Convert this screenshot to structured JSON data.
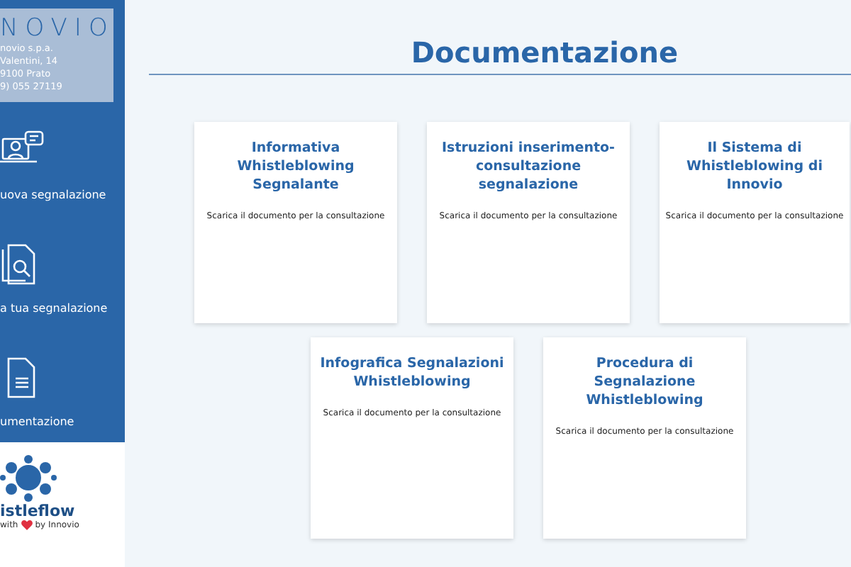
{
  "sidebar": {
    "logo": "NOVIO",
    "address": [
      "novio s.p.a.",
      "Valentini, 14",
      "9100 Prato",
      "9) 055 27119"
    ],
    "items": [
      {
        "kind": "new-report",
        "label": "uova segnalazione"
      },
      {
        "kind": "search-report",
        "label": "a tua segnalazione"
      },
      {
        "kind": "documents",
        "label": "umentazione"
      }
    ],
    "brand": {
      "name": "istleflow",
      "made_with": "with",
      "by": "by Innovio"
    }
  },
  "title": "Documentazione",
  "card_rows": [
    [
      {
        "title": "Informativa Whistleblowing Segnalante",
        "link": "Scarica il documento per la consultazione"
      },
      {
        "title": "Istruzioni inserimento-consultazione segnalazione",
        "link": "Scarica il documento per la consultazione"
      },
      {
        "title": "Il Sistema di Whistleblowing di Innovio",
        "link": "Scarica il documento per la consultazione"
      }
    ],
    [
      {
        "title": "Infografica Segnalazioni Whistleblowing",
        "link": "Scarica il documento per la consultazione"
      },
      {
        "title": "Procedura di Segnalazione Whistleblowing",
        "link": "Scarica il documento per la consultazione"
      }
    ]
  ]
}
